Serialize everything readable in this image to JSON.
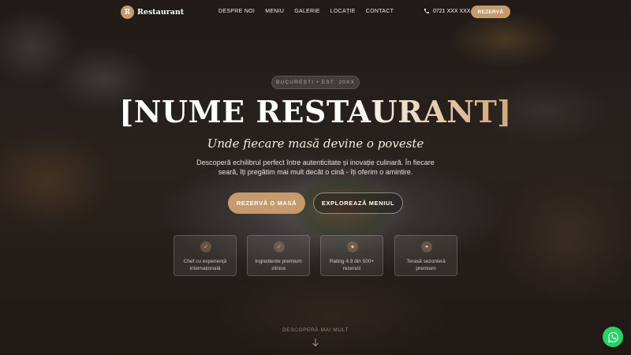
{
  "brand": {
    "mark": "R",
    "name": "Restaurant",
    "accent": "#c59a6c"
  },
  "nav": {
    "items": [
      "DESPRE NOI",
      "MENIU",
      "GALERIE",
      "LOCAȚIE",
      "CONTACT"
    ],
    "phone": "0721 XXX XXX",
    "phone_icon": "phone-icon",
    "cta": "REZERVĂ"
  },
  "hero": {
    "badge": "BUCUREȘTI • EST. 20XX",
    "title": "[NUME RESTAURANT]",
    "tagline": "Unde fiecare masă devine o poveste",
    "description": "Descoperă echilibrul perfect între autenticitate și inovație culinară. În fiecare seară, îți pregătim mai mult decât o cină - îți oferim o amintire.",
    "primary_button": "REZERVĂ O MASĂ",
    "secondary_button": "EXPLOREAZĂ MENIUL"
  },
  "features": [
    {
      "icon": "check-icon",
      "glyph": "✓",
      "text": "Chef cu experiență internațională"
    },
    {
      "icon": "check-icon",
      "glyph": "✓",
      "text": "Ingrediente premium zilnice"
    },
    {
      "icon": "star-icon",
      "glyph": "★",
      "text": "Rating 4.9 din 500+ recenzii"
    },
    {
      "icon": "sparkle-icon",
      "glyph": "✦",
      "text": "Terasă sezonieră premium"
    }
  ],
  "scroll_hint": "DESCOPERĂ MAI MULT",
  "whatsapp_color": "#25d366"
}
